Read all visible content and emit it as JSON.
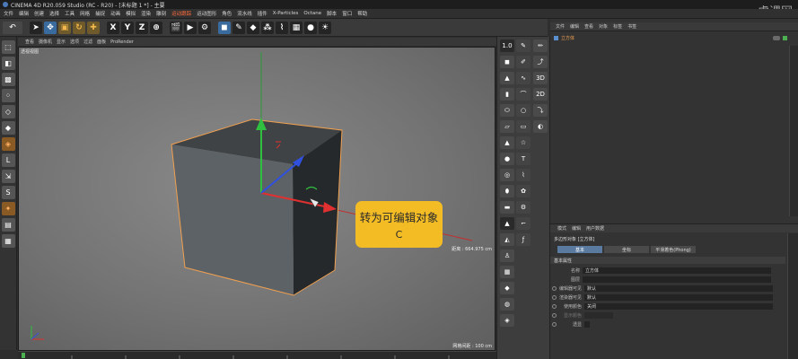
{
  "window": {
    "title": "CINEMA 4D R20.059 Studio (RC - R20) - [未标题 1 *] - 主要"
  },
  "watermark": "虎课网",
  "menu": [
    "文件",
    "编辑",
    "创建",
    "选择",
    "工具",
    "网格",
    "捕捉",
    "动画",
    "模拟",
    "渲染",
    "雕刻",
    "运动跟踪",
    "运动图形",
    "角色",
    "流水线",
    "插件",
    "X-Particles",
    "Octane",
    "脚本",
    "窗口",
    "帮助"
  ],
  "toolbar": {
    "undo_icon": "undo-icon",
    "axis_x": "X",
    "axis_y": "Y",
    "axis_z": "Z"
  },
  "viewport": {
    "menu": [
      "查看",
      "摄像机",
      "显示",
      "选项",
      "过滤",
      "面板",
      "ProRender"
    ],
    "camera_label": "透视视图",
    "distance": "距离 : 664.975 cm",
    "grid": "网格间距 : 100 cm"
  },
  "tooltip": {
    "line1": "转为可编辑对象",
    "line2": "C"
  },
  "palette": {
    "mid_labels": [
      "1.0",
      "3D",
      "2D"
    ]
  },
  "object_manager": {
    "menu": [
      "文件",
      "编辑",
      "查看",
      "对象",
      "标签",
      "书签"
    ],
    "objects": [
      {
        "name": "立方体"
      }
    ]
  },
  "attributes": {
    "menu": [
      "模式",
      "编辑",
      "用户数据"
    ],
    "object_label": "多边形对象 [立方体]",
    "tabs": [
      "基本",
      "坐标",
      "平滑着色(Phong)"
    ],
    "section": "基本属性",
    "rows": [
      {
        "label": "名称",
        "value": "立方体"
      },
      {
        "label": "图层",
        "value": ""
      },
      {
        "label": "编辑器可见",
        "value": "默认"
      },
      {
        "label": "渲染器可见",
        "value": "默认"
      },
      {
        "label": "使用颜色",
        "value": "关闭"
      },
      {
        "label": "显示颜色",
        "value": ""
      },
      {
        "label": "透显",
        "value": ""
      }
    ]
  },
  "colors": {
    "accent": "#f3bc25",
    "selection": "#f0a050",
    "x_axis": "#e03030",
    "y_axis": "#30c040",
    "z_axis": "#3050e0"
  }
}
